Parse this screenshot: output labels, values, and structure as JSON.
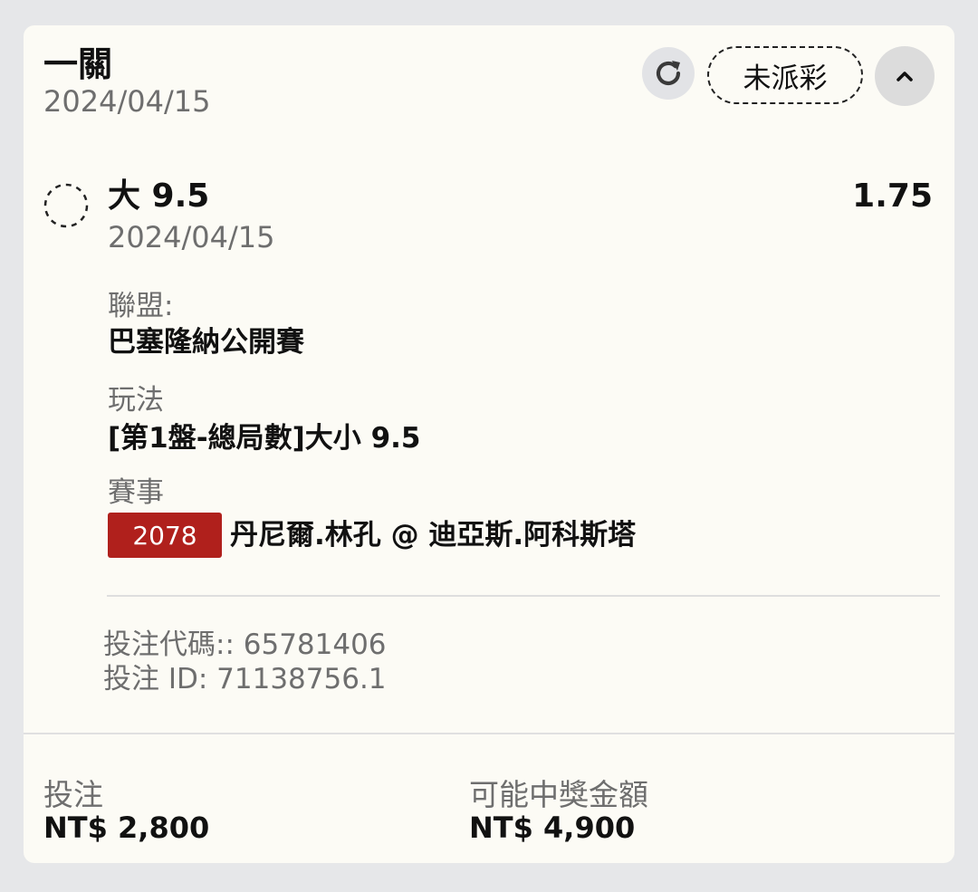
{
  "bet": {
    "title": "一關",
    "date": "2024/04/15",
    "status": "未派彩",
    "icons": {
      "refresh": "refresh-icon",
      "collapse": "chevron-up-icon",
      "pending": "pending-circle-icon"
    }
  },
  "selection": {
    "name": "大 9.5",
    "odds": "1.75",
    "date": "2024/04/15",
    "league_label": "聯盟:",
    "league": "巴塞隆納公開賽",
    "market_label": "玩法",
    "market": "[第1盤-總局數]大小 9.5",
    "event_label": "賽事",
    "event_number": "2078",
    "event_teams": "丹尼爾.林孔 @ 迪亞斯.阿科斯塔",
    "event_badge_color": "#b0201c"
  },
  "codes": {
    "bet_code": "投注代碼:: 65781406",
    "bet_id": "投注 ID: 71138756.1"
  },
  "footer": {
    "stake_label": "投注",
    "stake_value": "NT$ 2,800",
    "payout_label": "可能中獎金額",
    "payout_value": "NT$ 4,900"
  }
}
